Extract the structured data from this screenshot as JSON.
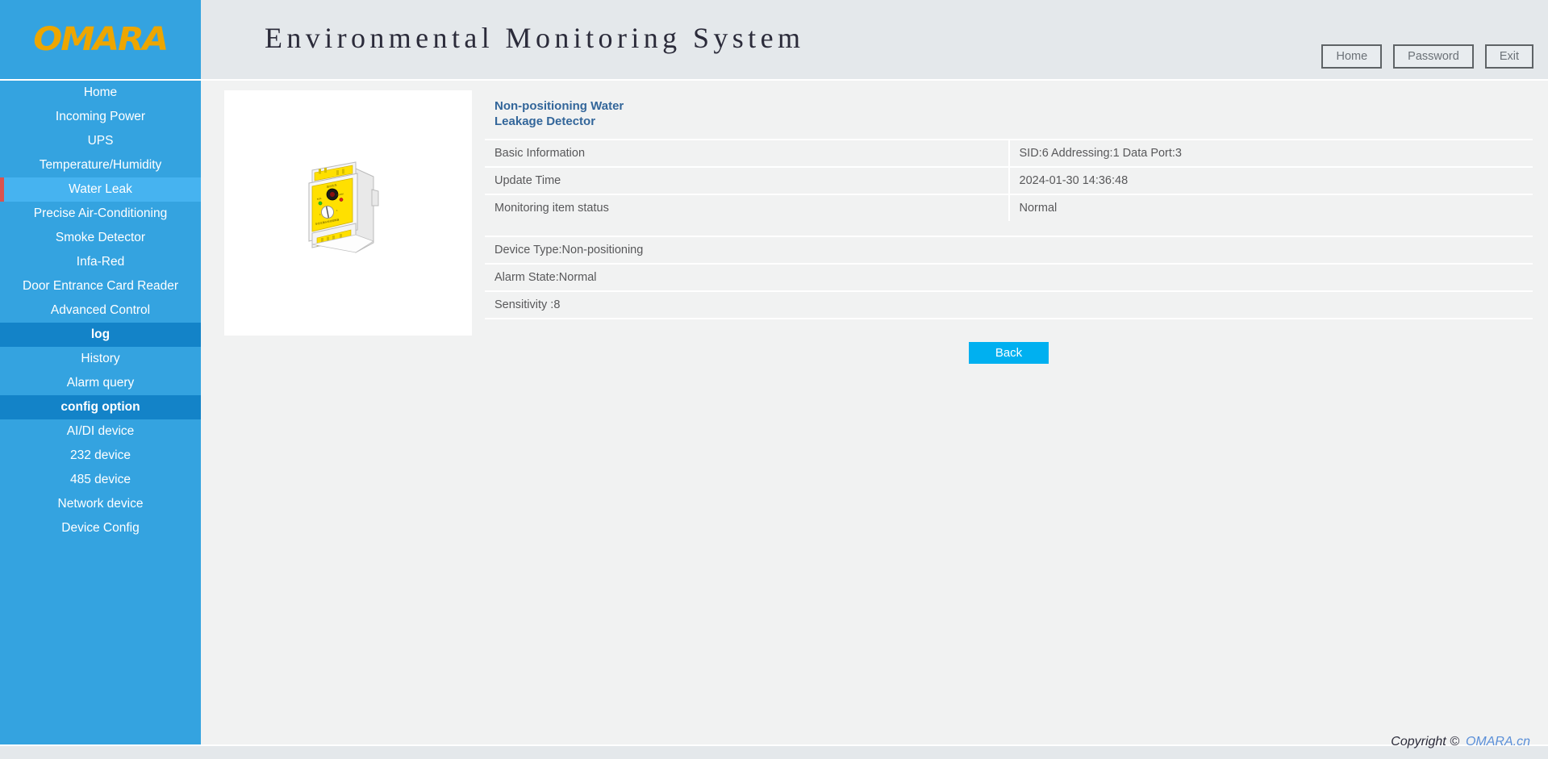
{
  "header": {
    "logo_text": "OMARA",
    "title": "Environmental Monitoring System",
    "buttons": [
      {
        "label": "Home",
        "name": "home-button"
      },
      {
        "label": "Password",
        "name": "password-button"
      },
      {
        "label": "Exit",
        "name": "exit-button"
      }
    ]
  },
  "sidebar": {
    "items": [
      {
        "label": "Home",
        "type": "item",
        "active": false
      },
      {
        "label": "Incoming Power",
        "type": "item",
        "active": false
      },
      {
        "label": "UPS",
        "type": "item",
        "active": false
      },
      {
        "label": "Temperature/Humidity",
        "type": "item",
        "active": false
      },
      {
        "label": "Water Leak",
        "type": "item",
        "active": true
      },
      {
        "label": "Precise Air-Conditioning",
        "type": "item",
        "active": false
      },
      {
        "label": "Smoke Detector",
        "type": "item",
        "active": false
      },
      {
        "label": "Infa-Red",
        "type": "item",
        "active": false
      },
      {
        "label": "Door Entrance Card Reader",
        "type": "item",
        "active": false
      },
      {
        "label": "Advanced Control",
        "type": "item",
        "active": false
      },
      {
        "label": "log",
        "type": "section"
      },
      {
        "label": "History",
        "type": "item",
        "active": false
      },
      {
        "label": "Alarm query",
        "type": "item",
        "active": false
      },
      {
        "label": "config option",
        "type": "section"
      },
      {
        "label": "AI/DI device",
        "type": "item",
        "active": false
      },
      {
        "label": "232 device",
        "type": "item",
        "active": false
      },
      {
        "label": "485 device",
        "type": "item",
        "active": false
      },
      {
        "label": "Network device",
        "type": "item",
        "active": false
      },
      {
        "label": "Device Config",
        "type": "item",
        "active": false
      }
    ]
  },
  "device": {
    "title": "Non-positioning Water Leakage Detector",
    "image_alt": "water-leak-detector-device",
    "info_rows": [
      {
        "label": "Basic Information",
        "value": "SID:6   Addressing:1   Data Port:3"
      },
      {
        "label": "Update Time",
        "value": "2024-01-30 14:36:48"
      },
      {
        "label": "Monitoring item status",
        "value": "Normal"
      }
    ],
    "detail_rows": [
      "Device Type:Non-positioning",
      "Alarm State:Normal",
      "Sensitivity :8"
    ],
    "back_label": "Back"
  },
  "footer": {
    "copyright": "Copyright ©",
    "brand": "OMARA.cn"
  },
  "colors": {
    "sidebar_blue": "#34a3e0",
    "sidebar_active": "#46b3f0",
    "sidebar_section": "#1383c8",
    "active_marker_red": "#d9534f",
    "logo_orange": "#eda600",
    "title_blue": "#33669a",
    "back_button": "#00b0f0",
    "header_bg": "#e4e8eb",
    "content_bg": "#f1f2f2",
    "brand_link": "#5a8fd8"
  }
}
